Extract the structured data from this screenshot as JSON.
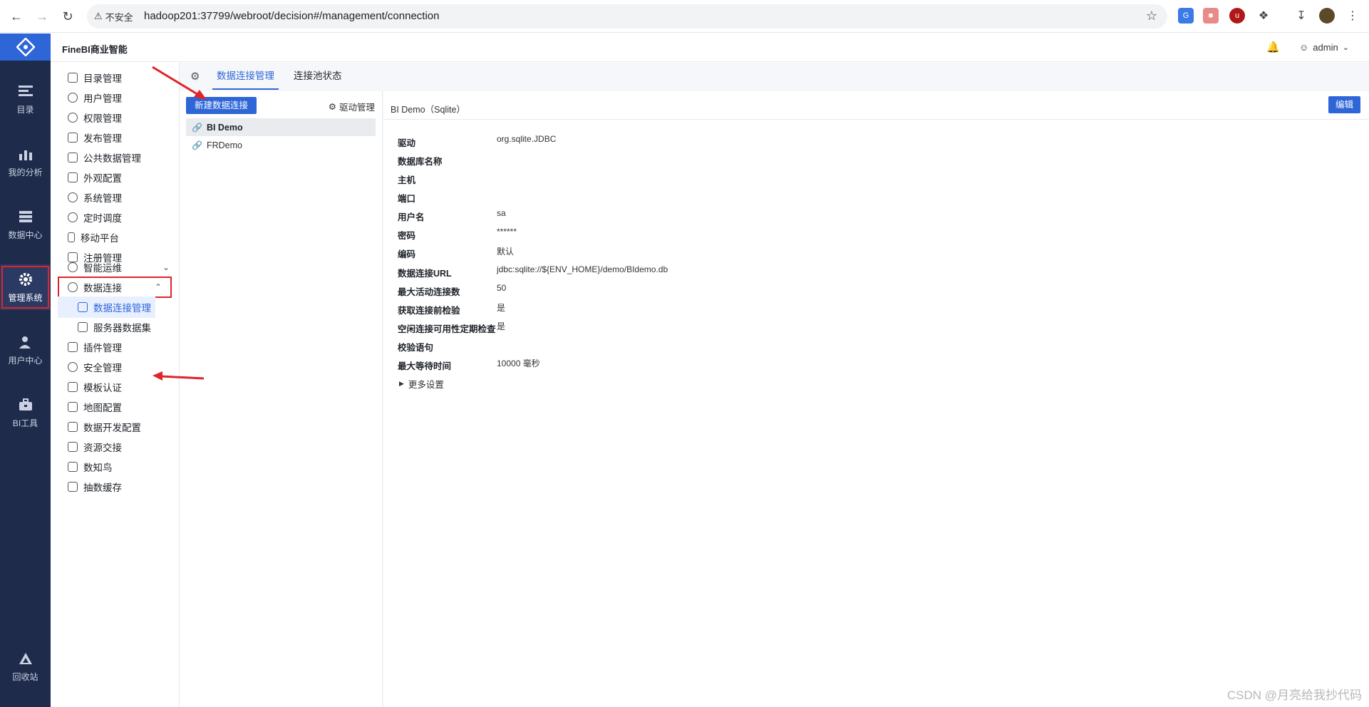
{
  "browser": {
    "insecure_label": "不安全",
    "url": "hadoop201:37799/webroot/decision#/management/connection"
  },
  "rail": {
    "items": [
      {
        "label": "目录",
        "icon": "catalog-icon"
      },
      {
        "label": "我的分析",
        "icon": "analysis-icon"
      },
      {
        "label": "数据中心",
        "icon": "database-icon"
      },
      {
        "label": "管理系统",
        "icon": "gear-icon",
        "active": true
      },
      {
        "label": "用户中心",
        "icon": "user-icon"
      },
      {
        "label": "BI工具",
        "icon": "toolbox-icon"
      },
      {
        "label": "回收站",
        "icon": "recycle-icon"
      }
    ]
  },
  "header": {
    "title": "FineBI商业智能",
    "username": "admin"
  },
  "menu": {
    "items": [
      {
        "label": "目录管理"
      },
      {
        "label": "用户管理"
      },
      {
        "label": "权限管理"
      },
      {
        "label": "发布管理"
      },
      {
        "label": "公共数据管理"
      },
      {
        "label": "外观配置"
      },
      {
        "label": "系统管理"
      },
      {
        "label": "定时调度"
      },
      {
        "label": "移动平台"
      },
      {
        "label": "注册管理"
      },
      {
        "label": "智能运维"
      },
      {
        "label": "数据连接"
      },
      {
        "label": "数据连接管理"
      },
      {
        "label": "服务器数据集"
      },
      {
        "label": "插件管理"
      },
      {
        "label": "安全管理"
      },
      {
        "label": "模板认证"
      },
      {
        "label": "地图配置"
      },
      {
        "label": "数据开发配置"
      },
      {
        "label": "资源交接"
      },
      {
        "label": "数知鸟"
      },
      {
        "label": "抽数缓存"
      }
    ]
  },
  "tabs": {
    "items": [
      {
        "label": "数据连接管理"
      },
      {
        "label": "连接池状态"
      }
    ]
  },
  "list": {
    "new_button": "新建数据连接",
    "driver_mgmt": "驱动管理",
    "connections": [
      "BI Demo",
      "FRDemo"
    ]
  },
  "detail": {
    "title": "BI Demo（Sqlite）",
    "edit_button": "编辑",
    "fields": [
      {
        "label": "驱动",
        "value": "org.sqlite.JDBC"
      },
      {
        "label": "数据库名称",
        "value": ""
      },
      {
        "label": "主机",
        "value": ""
      },
      {
        "label": "端口",
        "value": ""
      },
      {
        "label": "用户名",
        "value": "sa"
      },
      {
        "label": "密码",
        "value": "******"
      },
      {
        "label": "编码",
        "value": "默认"
      },
      {
        "label": "数据连接URL",
        "value": "jdbc:sqlite://${ENV_HOME}/demo/BIdemo.db"
      },
      {
        "label": "最大活动连接数",
        "value": "50"
      },
      {
        "label": "获取连接前检验",
        "value": "是"
      },
      {
        "label": "空闲连接可用性定期检查",
        "value": "是"
      },
      {
        "label": "校验语句",
        "value": ""
      },
      {
        "label": "最大等待时间",
        "value": "10000 毫秒"
      }
    ],
    "more_settings": "更多设置"
  },
  "watermark": "CSDN @月亮给我抄代码",
  "colors": {
    "accent": "#2e66d8",
    "rail_bg": "#1e2b4b",
    "annotation_red": "#e0242a"
  }
}
